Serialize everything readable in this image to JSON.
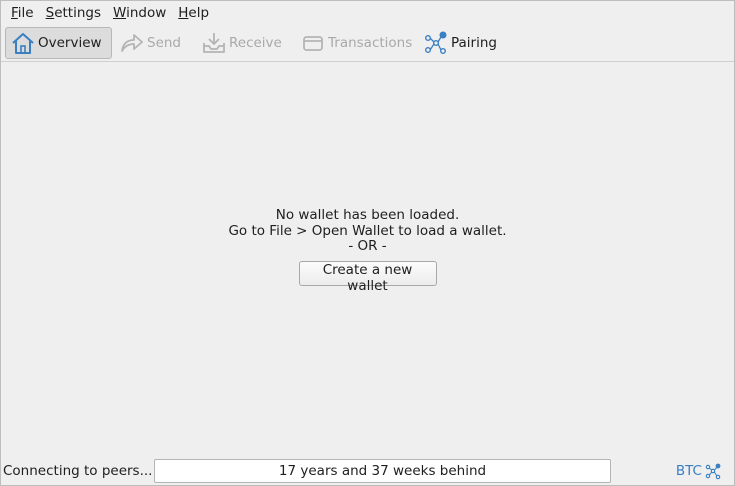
{
  "menu": {
    "file": {
      "mnemonic": "F",
      "rest": "ile"
    },
    "settings": {
      "mnemonic": "S",
      "rest": "ettings"
    },
    "window": {
      "mnemonic": "W",
      "rest": "indow"
    },
    "help": {
      "mnemonic": "H",
      "rest": "elp"
    }
  },
  "toolbar": {
    "overview": "Overview",
    "send": "Send",
    "receive": "Receive",
    "transactions": "Transactions",
    "pairing": "Pairing"
  },
  "main": {
    "line1": "No wallet has been loaded.",
    "line2": "Go to File > Open Wallet to load a wallet.",
    "line3": "- OR -",
    "create_button": "Create a new wallet"
  },
  "status": {
    "message": "Connecting to peers...",
    "progress_text": "17 years and 37 weeks behind",
    "unit": "BTC"
  },
  "icons": {
    "overview": "home-icon",
    "send": "send-arrow-icon",
    "receive": "receive-tray-icon",
    "transactions": "card-icon",
    "pairing": "pairing-network-icon",
    "status": "network-sync-icon"
  },
  "colors": {
    "accent": "#3a7fc2",
    "disabled_text": "#a9a9a9"
  }
}
